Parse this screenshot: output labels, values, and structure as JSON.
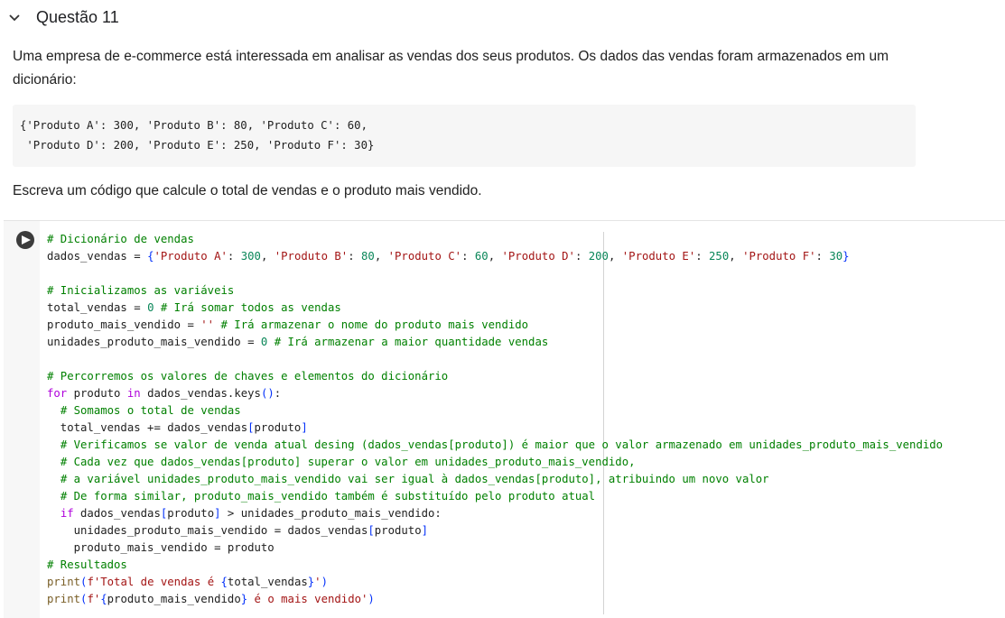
{
  "section": {
    "title": "Questão 11",
    "icon": "chevron-down-icon"
  },
  "markdown": {
    "paragraph1": "Uma empresa de e-commerce está interessada em analisar as vendas dos seus produtos. Os dados das vendas foram armazenados em um dicionário:",
    "dict_lines": [
      "{'Produto A': 300, 'Produto B': 80, 'Produto C': 60,",
      " 'Produto D': 200, 'Produto E': 250, 'Produto F': 30}"
    ],
    "paragraph2": "Escreva um código que calcule o total de vendas e o produto mais vendido."
  },
  "cell": {
    "run_icon": "play-icon",
    "code_lines": [
      [
        [
          "comment",
          "# Dicionário de vendas"
        ]
      ],
      [
        [
          "plain",
          "dados_vendas = "
        ],
        [
          "bracket",
          "{"
        ],
        [
          "string",
          "'Produto A'"
        ],
        [
          "plain",
          ": "
        ],
        [
          "number",
          "300"
        ],
        [
          "plain",
          ", "
        ],
        [
          "string",
          "'Produto B'"
        ],
        [
          "plain",
          ": "
        ],
        [
          "number",
          "80"
        ],
        [
          "plain",
          ", "
        ],
        [
          "string",
          "'Produto C'"
        ],
        [
          "plain",
          ": "
        ],
        [
          "number",
          "60"
        ],
        [
          "plain",
          ", "
        ],
        [
          "string",
          "'Produto D'"
        ],
        [
          "plain",
          ": "
        ],
        [
          "number",
          "200"
        ],
        [
          "plain",
          ", "
        ],
        [
          "string",
          "'Produto E'"
        ],
        [
          "plain",
          ": "
        ],
        [
          "number",
          "250"
        ],
        [
          "plain",
          ", "
        ],
        [
          "string",
          "'Produto F'"
        ],
        [
          "plain",
          ": "
        ],
        [
          "number",
          "30"
        ],
        [
          "bracket",
          "}"
        ]
      ],
      [],
      [
        [
          "comment",
          "# Inicializamos as variáveis"
        ]
      ],
      [
        [
          "plain",
          "total_vendas = "
        ],
        [
          "number",
          "0"
        ],
        [
          "plain",
          " "
        ],
        [
          "comment",
          "# Irá somar todos as vendas"
        ]
      ],
      [
        [
          "plain",
          "produto_mais_vendido = "
        ],
        [
          "string",
          "''"
        ],
        [
          "plain",
          " "
        ],
        [
          "comment",
          "# Irá armazenar o nome do produto mais vendido"
        ]
      ],
      [
        [
          "plain",
          "unidades_produto_mais_vendido = "
        ],
        [
          "number",
          "0"
        ],
        [
          "plain",
          " "
        ],
        [
          "comment",
          "# Irá armazenar a maior quantidade vendas"
        ]
      ],
      [],
      [
        [
          "comment",
          "# Percorremos os valores de chaves e elementos do dicionário"
        ]
      ],
      [
        [
          "keyword",
          "for"
        ],
        [
          "plain",
          " produto "
        ],
        [
          "keyword",
          "in"
        ],
        [
          "plain",
          " dados_vendas.keys"
        ],
        [
          "bracket",
          "()"
        ],
        [
          "plain",
          ":"
        ]
      ],
      [
        [
          "plain",
          "  "
        ],
        [
          "comment",
          "# Somamos o total de vendas"
        ]
      ],
      [
        [
          "plain",
          "  total_vendas += dados_vendas"
        ],
        [
          "bracket",
          "["
        ],
        [
          "plain",
          "produto"
        ],
        [
          "bracket",
          "]"
        ]
      ],
      [
        [
          "plain",
          "  "
        ],
        [
          "comment",
          "# Verificamos se valor de venda atual desing (dados_vendas[produto]) é maior que o valor armazenado em unidades_produto_mais_vendido"
        ]
      ],
      [
        [
          "plain",
          "  "
        ],
        [
          "comment",
          "# Cada vez que dados_vendas[produto] superar o valor em unidades_produto_mais_vendido,"
        ]
      ],
      [
        [
          "plain",
          "  "
        ],
        [
          "comment",
          "# a variável unidades_produto_mais_vendido vai ser igual à dados_vendas[produto], atribuindo um novo valor"
        ]
      ],
      [
        [
          "plain",
          "  "
        ],
        [
          "comment",
          "# De forma similar, produto_mais_vendido também é substituído pelo produto atual"
        ]
      ],
      [
        [
          "plain",
          "  "
        ],
        [
          "keyword",
          "if"
        ],
        [
          "plain",
          " dados_vendas"
        ],
        [
          "bracket",
          "["
        ],
        [
          "plain",
          "produto"
        ],
        [
          "bracket",
          "]"
        ],
        [
          "plain",
          " > unidades_produto_mais_vendido:"
        ]
      ],
      [
        [
          "plain",
          "    unidades_produto_mais_vendido = dados_vendas"
        ],
        [
          "bracket",
          "["
        ],
        [
          "plain",
          "produto"
        ],
        [
          "bracket",
          "]"
        ]
      ],
      [
        [
          "plain",
          "    produto_mais_vendido = produto"
        ]
      ],
      [
        [
          "comment",
          "# Resultados"
        ]
      ],
      [
        [
          "builtin",
          "print"
        ],
        [
          "bracket",
          "("
        ],
        [
          "string",
          "f'Total de vendas é "
        ],
        [
          "bracket",
          "{"
        ],
        [
          "plain",
          "total_vendas"
        ],
        [
          "bracket",
          "}"
        ],
        [
          "string",
          "'"
        ],
        [
          "bracket",
          ")"
        ]
      ],
      [
        [
          "builtin",
          "print"
        ],
        [
          "bracket",
          "("
        ],
        [
          "string",
          "f'"
        ],
        [
          "bracket",
          "{"
        ],
        [
          "plain",
          "produto_mais_vendido"
        ],
        [
          "bracket",
          "}"
        ],
        [
          "string",
          " é o mais vendido'"
        ],
        [
          "bracket",
          ")"
        ]
      ]
    ]
  }
}
